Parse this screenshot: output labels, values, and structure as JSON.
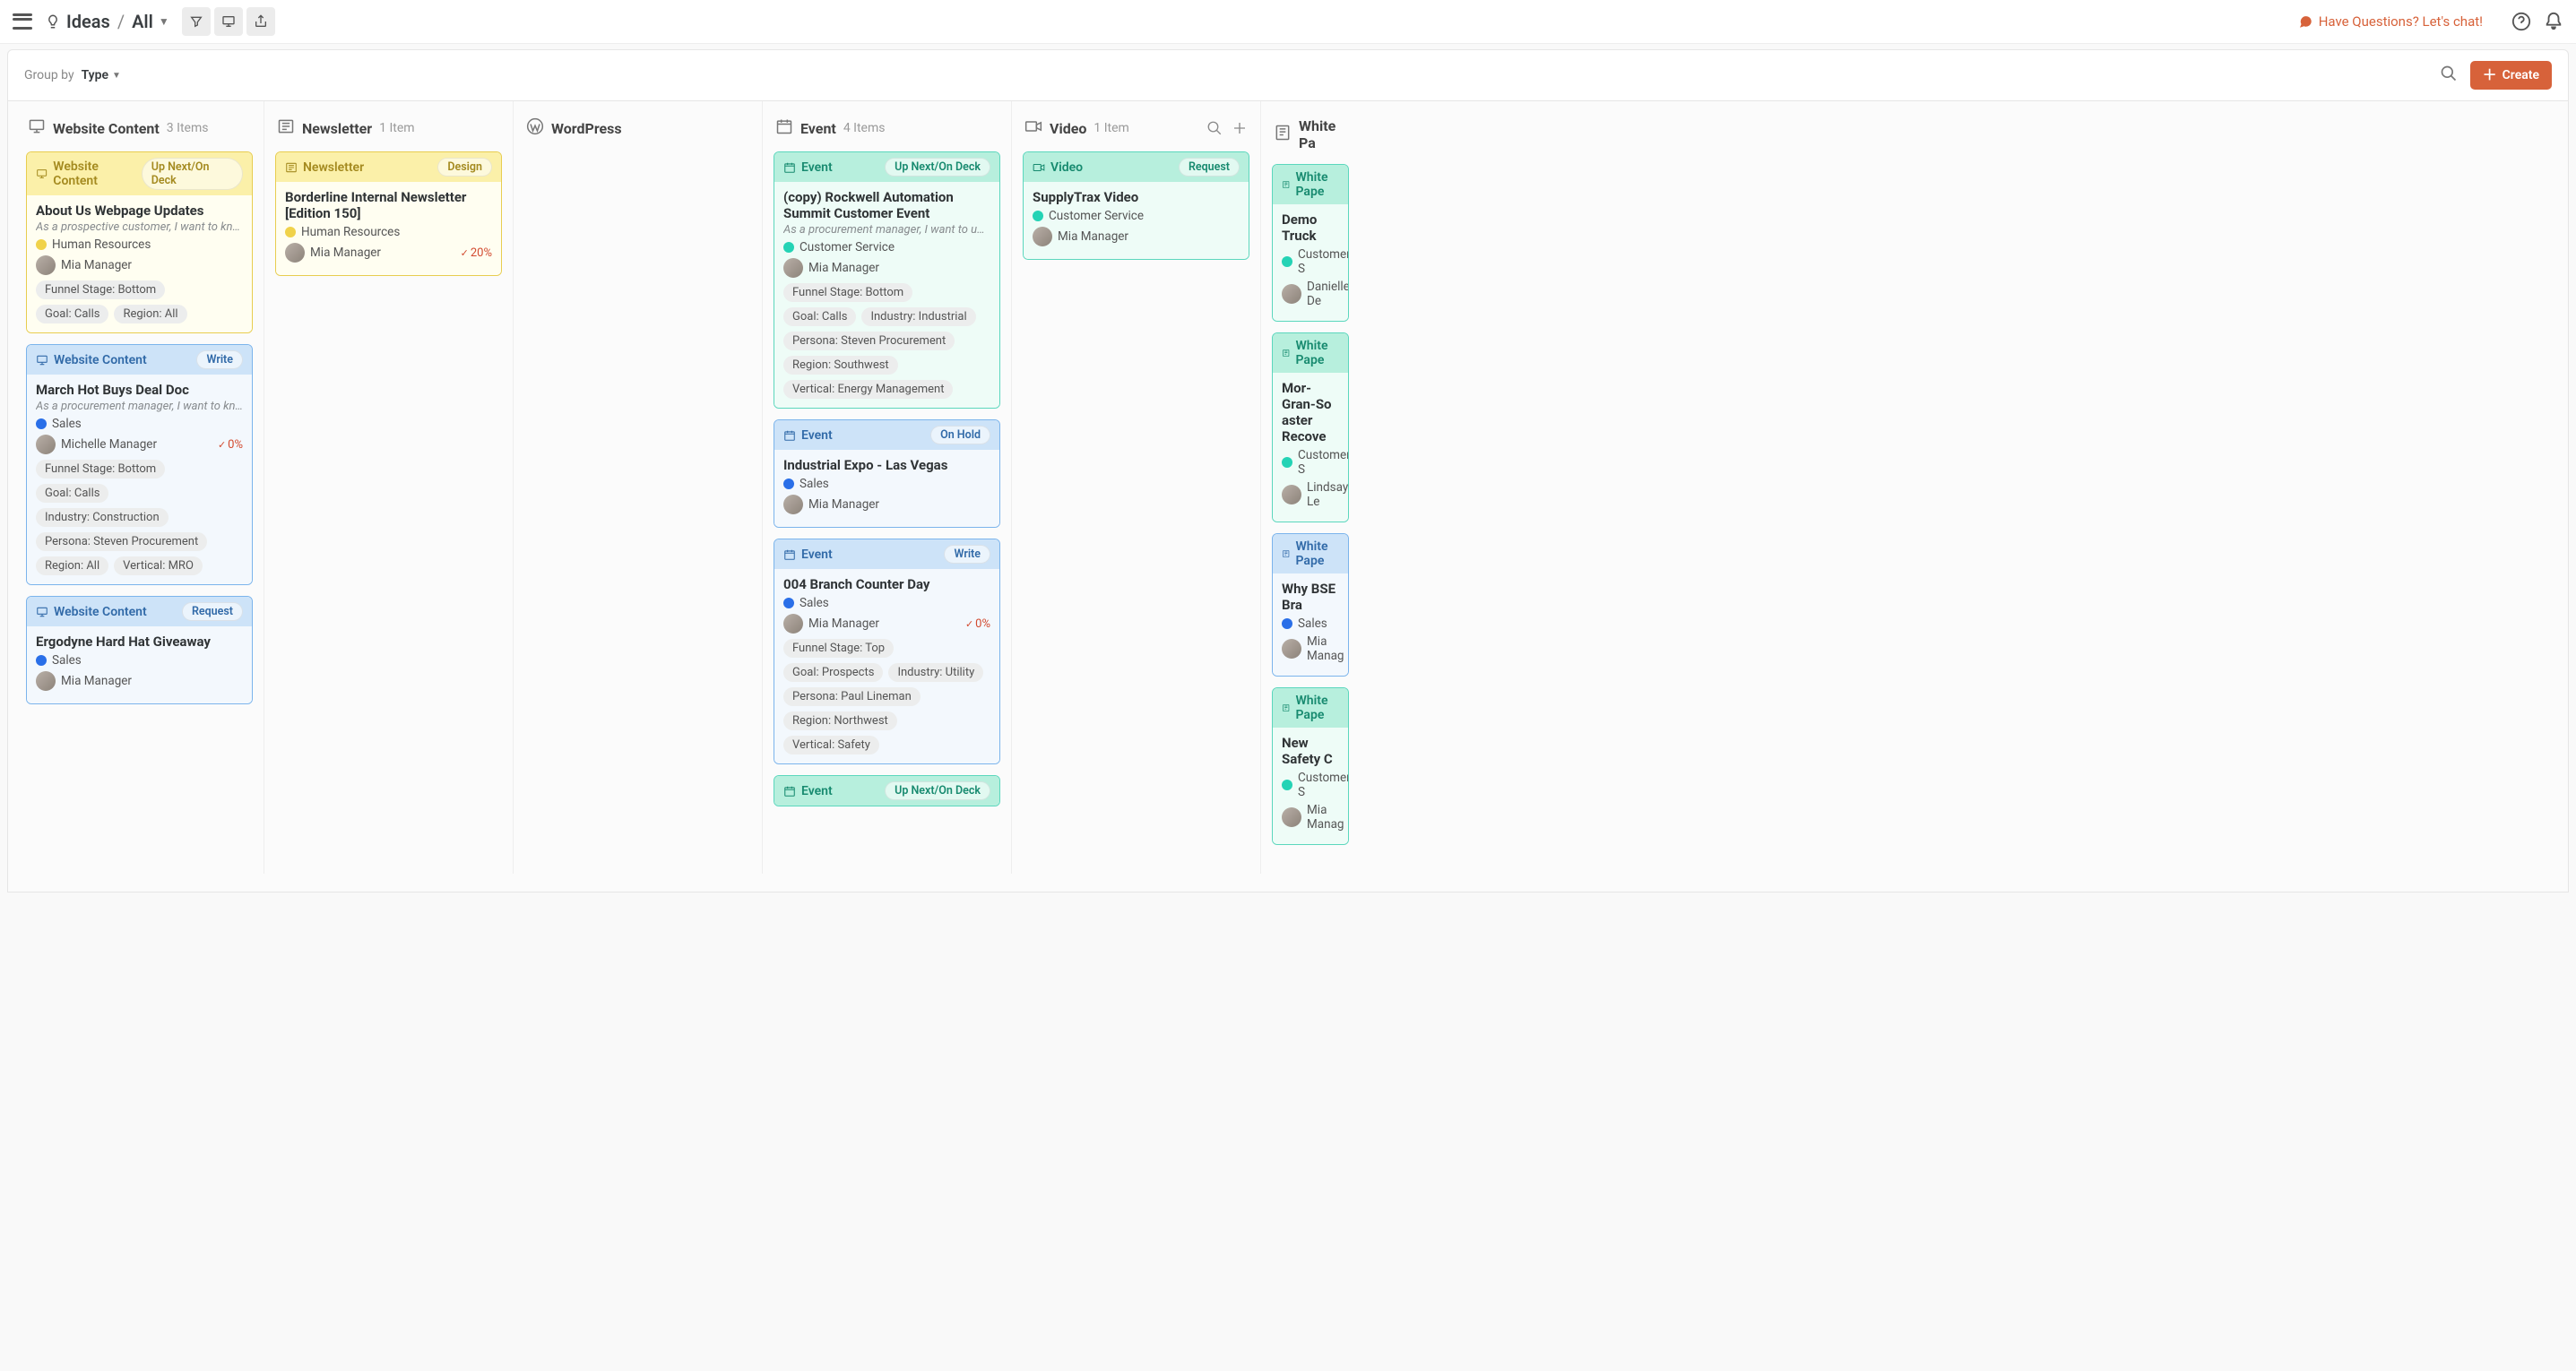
{
  "topbar": {
    "breadcrumb_root": "Ideas",
    "breadcrumb_view": "All",
    "chat_label": "Have Questions? Let's chat!"
  },
  "groupbar": {
    "label": "Group by",
    "value": "Type",
    "create_label": "Create"
  },
  "columns": [
    {
      "icon": "monitor",
      "title": "Website Content",
      "count_label": "3 Items",
      "cards": [
        {
          "variant": "yellow",
          "type_label": "Website Content",
          "type_icon": "monitor",
          "status": "Up Next/On Deck",
          "title": "About Us Webpage Updates",
          "description": "As a prospective customer, I want to kno…",
          "category": {
            "dot": "hr",
            "label": "Human Resources"
          },
          "owner": "Mia Manager",
          "percent": null,
          "tags": [
            "Funnel Stage: Bottom",
            "Goal: Calls",
            "Region: All"
          ]
        },
        {
          "variant": "blue",
          "type_label": "Website Content",
          "type_icon": "monitor",
          "status": "Write",
          "title": "March Hot Buys Deal Doc",
          "description": "As a procurement manager, I want to kno…",
          "category": {
            "dot": "sales",
            "label": "Sales"
          },
          "owner": "Michelle Manager",
          "percent": "0%",
          "tags": [
            "Funnel Stage: Bottom",
            "Goal: Calls",
            "Industry: Construction",
            "Persona: Steven Procurement",
            "Region: All",
            "Vertical: MRO"
          ]
        },
        {
          "variant": "blue",
          "type_label": "Website Content",
          "type_icon": "monitor",
          "status": "Request",
          "title": "Ergodyne Hard Hat Giveaway",
          "description": null,
          "category": {
            "dot": "sales",
            "label": "Sales"
          },
          "owner": "Mia Manager",
          "percent": null,
          "tags": []
        }
      ]
    },
    {
      "icon": "newsletter",
      "title": "Newsletter",
      "count_label": "1 Item",
      "cards": [
        {
          "variant": "yellow",
          "type_label": "Newsletter",
          "type_icon": "newsletter",
          "status": "Design",
          "title": "Borderline Internal Newsletter [Edition 150]",
          "description": null,
          "category": {
            "dot": "hr",
            "label": "Human Resources"
          },
          "owner": "Mia Manager",
          "percent": "20%",
          "tags": []
        }
      ]
    },
    {
      "icon": "wordpress",
      "title": "WordPress",
      "count_label": "",
      "cards": []
    },
    {
      "icon": "calendar",
      "title": "Event",
      "count_label": "4 Items",
      "cards": [
        {
          "variant": "teal",
          "type_label": "Event",
          "type_icon": "calendar",
          "status": "Up Next/On Deck",
          "title": "(copy) Rockwell Automation Summit Customer Event",
          "description": "As a procurement manager, I want to und…",
          "category": {
            "dot": "cs",
            "label": "Customer Service"
          },
          "owner": "Mia Manager",
          "percent": null,
          "tags": [
            "Funnel Stage: Bottom",
            "Goal: Calls",
            "Industry: Industrial",
            "Persona: Steven Procurement",
            "Region: Southwest",
            "Vertical: Energy Management"
          ]
        },
        {
          "variant": "blue",
          "type_label": "Event",
          "type_icon": "calendar",
          "status": "On Hold",
          "title": "Industrial Expo - Las Vegas",
          "description": null,
          "category": {
            "dot": "sales",
            "label": "Sales"
          },
          "owner": "Mia Manager",
          "percent": null,
          "tags": []
        },
        {
          "variant": "blue",
          "type_label": "Event",
          "type_icon": "calendar",
          "status": "Write",
          "title": "004 Branch Counter Day",
          "description": null,
          "category": {
            "dot": "sales",
            "label": "Sales"
          },
          "owner": "Mia Manager",
          "percent": "0%",
          "tags": [
            "Funnel Stage: Top",
            "Goal: Prospects",
            "Industry: Utility",
            "Persona: Paul Lineman",
            "Region: Northwest",
            "Vertical: Safety"
          ]
        },
        {
          "variant": "teal",
          "type_label": "Event",
          "type_icon": "calendar",
          "status": "Up Next/On Deck",
          "title": "",
          "partial": true
        }
      ]
    },
    {
      "icon": "video",
      "title": "Video",
      "count_label": "1 Item",
      "has_actions": true,
      "cards": [
        {
          "variant": "teal",
          "type_label": "Video",
          "type_icon": "video",
          "status": "Request",
          "title": "SupplyTrax Video",
          "description": null,
          "category": {
            "dot": "cs",
            "label": "Customer Service"
          },
          "owner": "Mia Manager",
          "percent": null,
          "tags": []
        }
      ]
    },
    {
      "icon": "paper",
      "title": "White Pa",
      "count_label": "",
      "truncated": true,
      "cards": [
        {
          "variant": "teal",
          "type_label": "White Pape",
          "type_icon": "paper",
          "status": "",
          "title": "Demo Truck",
          "category": {
            "dot": "cs",
            "label": "Customer S"
          },
          "owner": "Danielle De",
          "tags": []
        },
        {
          "variant": "teal",
          "type_label": "White Pape",
          "type_icon": "paper",
          "status": "",
          "title": "Mor-Gran-So aster Recove",
          "category": {
            "dot": "cs",
            "label": "Customer S"
          },
          "owner": "Lindsay Le",
          "tags": []
        },
        {
          "variant": "blue",
          "type_label": "White Pape",
          "type_icon": "paper",
          "status": "",
          "title": "Why BSE Bra",
          "category": {
            "dot": "sales",
            "label": "Sales"
          },
          "owner": "Mia Manag",
          "tags": []
        },
        {
          "variant": "teal",
          "type_label": "White Pape",
          "type_icon": "paper",
          "status": "",
          "title": "New Safety C",
          "category": {
            "dot": "cs",
            "label": "Customer S"
          },
          "owner": "Mia Manag",
          "tags": []
        }
      ]
    }
  ]
}
